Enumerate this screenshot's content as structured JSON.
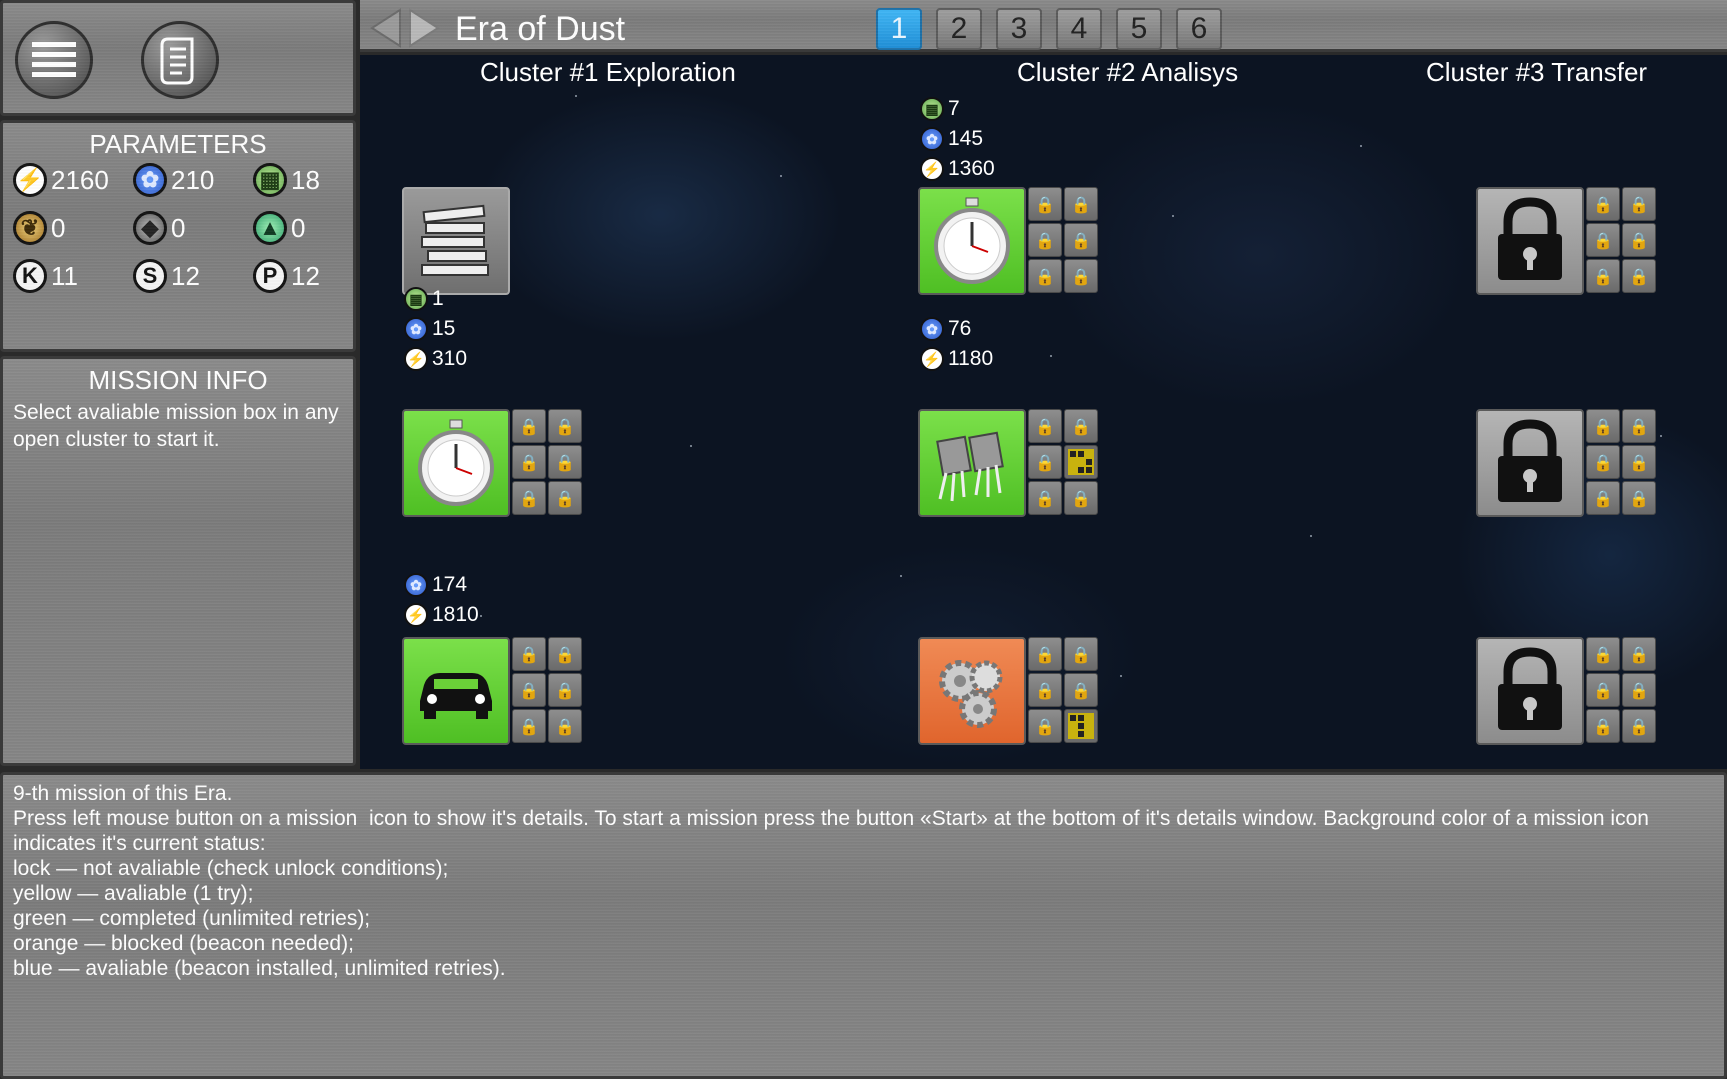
{
  "window": {
    "title": "Era of Dust"
  },
  "tabs": [
    "1",
    "2",
    "3",
    "4",
    "5",
    "6"
  ],
  "active_tab": "1",
  "toolbar": {
    "menu_icon": "menu-icon",
    "log_icon": "scroll-icon"
  },
  "parameters": {
    "title": "PARAMETERS",
    "items": [
      {
        "icon": "energy",
        "value": "2160"
      },
      {
        "icon": "crystal",
        "value": "210"
      },
      {
        "icon": "chip",
        "value": "18"
      },
      {
        "icon": "seed",
        "value": "0"
      },
      {
        "icon": "rock",
        "value": "0"
      },
      {
        "icon": "tree",
        "value": "0"
      },
      {
        "icon": "K",
        "value": "11"
      },
      {
        "icon": "S",
        "value": "12"
      },
      {
        "icon": "P",
        "value": "12"
      }
    ]
  },
  "mission_info": {
    "title": "MISSION INFO",
    "text": "Select avaliable mission box in any open cluster to start it."
  },
  "clusters": [
    {
      "title": "Cluster #1 Exploration"
    },
    {
      "title": "Cluster #2 Analisys"
    },
    {
      "title": "Cluster #3 Transfer"
    }
  ],
  "missions": {
    "c1_top": {
      "status": "gray",
      "icon": "books-icon"
    },
    "c1_mid": {
      "status": "green",
      "icon": "stopwatch-icon",
      "req": [
        "1",
        "15",
        "310"
      ]
    },
    "c1_bot": {
      "status": "green",
      "icon": "car-icon",
      "req": [
        "174",
        "1810"
      ]
    },
    "c2_top": {
      "status": "green",
      "icon": "stopwatch-icon",
      "req": [
        "7",
        "145",
        "1360"
      ]
    },
    "c2_mid": {
      "status": "green",
      "icon": "transistor-icon",
      "req": [
        "76",
        "1180"
      ]
    },
    "c2_bot": {
      "status": "orange",
      "icon": "gears-icon"
    },
    "c3_top": {
      "status": "lock",
      "icon": "lock-icon"
    },
    "c3_mid": {
      "status": "lock",
      "icon": "lock-icon"
    },
    "c3_bot": {
      "status": "lock",
      "icon": "lock-icon"
    }
  },
  "bottom_info": {
    "lines": [
      "9-th mission of this Era.",
      "Press left mouse button on a mission  icon to show it's details. To start a mission press the button «Start» at the bottom of it's details window. Background color of a mission icon indicates it's current status:",
      "lock — not avaliable (check unlock conditions);",
      "yellow — avaliable (1 try);",
      "green — completed (unlimited retries);",
      "orange — blocked (beacon needed);",
      "blue — avaliable (beacon installed, unlimited retries)."
    ]
  }
}
